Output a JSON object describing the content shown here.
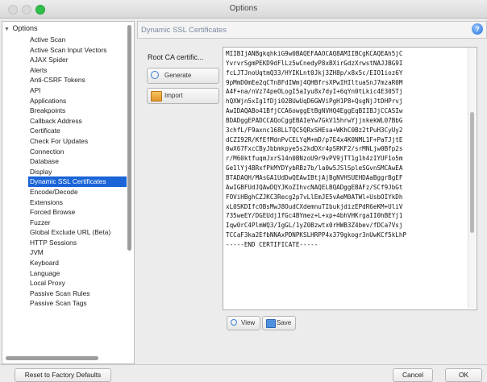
{
  "window": {
    "title": "Options"
  },
  "sidebar": {
    "root_label": "Options",
    "items": [
      "Active Scan",
      "Active Scan Input Vectors",
      "AJAX Spider",
      "Alerts",
      "Anti-CSRF Tokens",
      "API",
      "Applications",
      "Breakpoints",
      "Callback Address",
      "Certificate",
      "Check For Updates",
      "Connection",
      "Database",
      "Display",
      "Dynamic SSL Certificates",
      "Encode/Decode",
      "Extensions",
      "Forced Browse",
      "Fuzzer",
      "Global Exclude URL (Beta)",
      "HTTP Sessions",
      "JVM",
      "Keyboard",
      "Language",
      "Local Proxy",
      "Passive Scan Rules",
      "Passive Scan Tags"
    ],
    "selected_index": 14
  },
  "panel": {
    "title": "Dynamic SSL Certificates",
    "root_ca_label": "Root CA certific...",
    "generate_label": "Generate",
    "import_label": "Import",
    "view_label": "View",
    "save_label": "Save",
    "cert_lines": [
      "MIIBIjANBgkqhkiG9w0BAQEFAAOCAQ8AMIIBCgKCAQEAh5jC",
      "YvrvrSgmPEKD9dFlLz5wCnedyP8xBXirGdzXrwstNAJJBG9I",
      "fcLJTJnoUqtmQ33/HYIKLnt0Jkj3ZH8p/x8x5c/EIO1ioz6Y",
      "9pMmD0mEe2qCTn8FdIWmj4QHBfrsXPwIHIltuaSnJ7mzaR0M",
      "A4F+na/nVz74peOLogI5aIyu8x7dyI+6qYn0tLkic4E305Tj",
      "hQXWjn5xIg1fDji02BUwUqD6GWViPgH1P8+QsgNjJtDHPrvj",
      "AwIDAQABo41BfjCCA6owggEtBgNVHQ4EggEqBIIBJjCCASIw",
      "BDADggEPADCCAQoCggEBAIeYw7GkV15hrwYjjnkekWL07BbG",
      "3chfL/F9axnc168LLTQC5QRxSHEsa+WKhC0Bz2tPuH3CyUy2",
      "dCZI92R/KfEfMdnPvCELYqM+mD/p7E4x4K0NML1F+PaTJjtE",
      "0wX67FxcCByJbbmkpye5s2kdDXr4pSRKF2/srMNLjw0Bfp2s",
      "r/M60ktfuqmJxrS14n0BNzoU9r9vPV9jTT1g1h4zIYUF1o5m",
      "Ge1lYj4BRxfPkMYDYybRBz7b/la0w5JSlSpleSGvnSMCAwEA",
      "BTADAQH/MAsGA1UdDwQEAwIBtjAjBgNVHSUEHDAaBggrBgEF",
      "AwIGBFUdJQAwDQYJKoZIhvcNAQELBQADggEBAFz/SCf9JbGt",
      "FOViHBghCZJKC3Recg2p7vLlEmJE5vAeM0ATWl+UsbOIYkDh",
      "xL0SKDIfcOBsMwJ8OudCXdemnuTIbukjdizEPdR6eKM+UliV",
      "735weEY/DGEUdj1fGc4BYmez+L+xp+4bhVHKrgaII0hBEYj1",
      "Iqw0rC4PlmWQ3/IgGL/1yZ0Bzwtx0rHWB3Z4bev/fDCa7Vsj",
      "TCCaF3ka2EfbNNAxPDNPKSLHRPP4x379gkogr3nUwKCf5kLhP",
      "-----END CERTIFICATE-----"
    ]
  },
  "footer": {
    "reset_label": "Reset to Factory Defaults",
    "cancel_label": "Cancel",
    "ok_label": "OK"
  }
}
